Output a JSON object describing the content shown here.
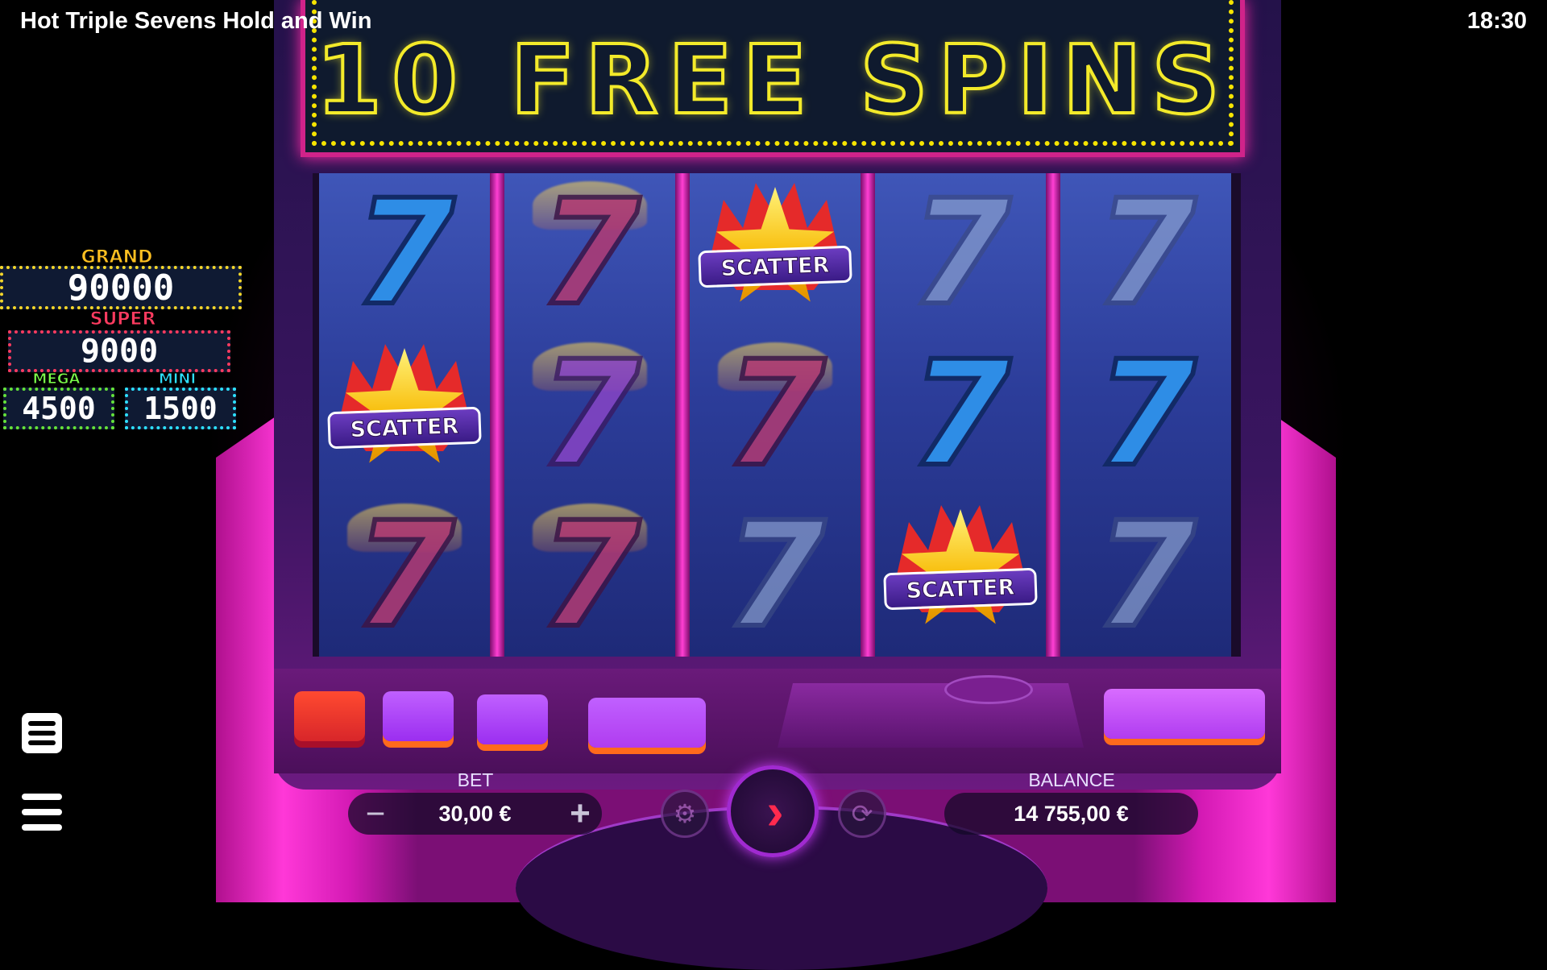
{
  "header": {
    "game_title": "Hot Triple Sevens Hold and Win",
    "clock": "18:30"
  },
  "marquee": {
    "text": "10 FREE SPINS"
  },
  "jackpots": {
    "grand": {
      "label": "GRAND",
      "value": "90000",
      "color": "#f4d62a"
    },
    "super": {
      "label": "SUPER",
      "value": "9000",
      "color": "#ff3b60"
    },
    "mega": {
      "label": "MEGA",
      "value": "4500",
      "color": "#65e23a"
    },
    "mini": {
      "label": "MINI",
      "value": "1500",
      "color": "#2ee0ff"
    }
  },
  "reels": [
    [
      "seven-blue",
      "scatter",
      "seven-red"
    ],
    [
      "seven-red",
      "seven-purple",
      "seven-red"
    ],
    [
      "scatter",
      "seven-red",
      "seven-grey"
    ],
    [
      "seven-grey",
      "seven-blue",
      "scatter"
    ],
    [
      "seven-grey",
      "seven-blue",
      "seven-grey"
    ]
  ],
  "symbols": {
    "seven_glyph": "7",
    "scatter_label": "SCATTER"
  },
  "controls": {
    "bet_label": "BET",
    "bet_value": "30,00 €",
    "bet_minus": "−",
    "bet_plus": "+",
    "balance_label": "BALANCE",
    "balance_value": "14 755,00 €",
    "spin_icon": "›",
    "coin_settings_icon": "⚙",
    "autoplay_icon": "⟳"
  },
  "icons": {
    "paytable": "paytable-icon",
    "menu": "hamburger-menu-icon",
    "spin": "spin-arrow-icon",
    "coin_settings": "coin-settings-icon",
    "autoplay": "autoplay-icon"
  },
  "colors": {
    "cabinet_pink": "#ff38d8",
    "marquee_dots": "#f3ea2a",
    "spin_arrow": "#ff2a4e"
  }
}
